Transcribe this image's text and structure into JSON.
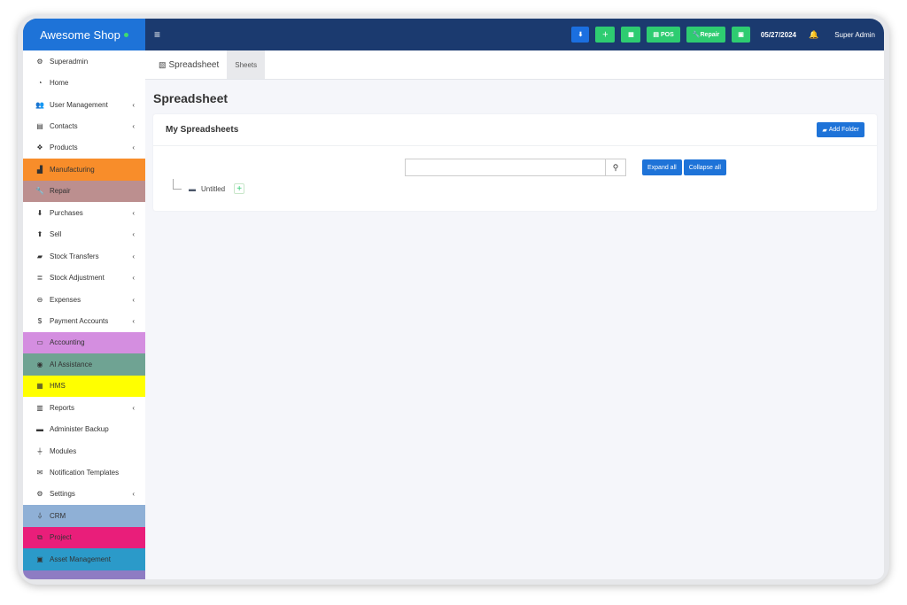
{
  "brand": {
    "name": "Awesome Shop"
  },
  "topbar": {
    "menu_icon": "≡",
    "pos_label": "POS",
    "repair_label": "Repair",
    "date": "05/27/2024",
    "user": "Super Admin"
  },
  "sidebar": {
    "items": [
      {
        "label": "Superadmin",
        "icon": "users-cog-icon",
        "glyph": "⚙",
        "bg": "",
        "chevron": ""
      },
      {
        "label": "Home",
        "icon": "dashboard-icon",
        "glyph": "◔",
        "bg": "",
        "chevron": ""
      },
      {
        "label": "User Management",
        "icon": "users-icon",
        "glyph": "👥",
        "bg": "",
        "chevron": "‹"
      },
      {
        "label": "Contacts",
        "icon": "address-book-icon",
        "glyph": "▤",
        "bg": "",
        "chevron": "‹"
      },
      {
        "label": "Products",
        "icon": "cubes-icon",
        "glyph": "❖",
        "bg": "",
        "chevron": "‹"
      },
      {
        "label": "Manufacturing",
        "icon": "industry-icon",
        "glyph": "▟",
        "bg": "#f88d2a",
        "chevron": ""
      },
      {
        "label": "Repair",
        "icon": "wrench-icon",
        "glyph": "🔧",
        "bg": "#bc8f8f",
        "chevron": ""
      },
      {
        "label": "Purchases",
        "icon": "arrow-circle-down-icon",
        "glyph": "⬇",
        "bg": "",
        "chevron": "‹"
      },
      {
        "label": "Sell",
        "icon": "arrow-circle-up-icon",
        "glyph": "⬆",
        "bg": "",
        "chevron": "‹"
      },
      {
        "label": "Stock Transfers",
        "icon": "truck-icon",
        "glyph": "▰",
        "bg": "",
        "chevron": "‹"
      },
      {
        "label": "Stock Adjustment",
        "icon": "database-icon",
        "glyph": "≣",
        "bg": "",
        "chevron": "‹"
      },
      {
        "label": "Expenses",
        "icon": "minus-circle-icon",
        "glyph": "⊖",
        "bg": "",
        "chevron": "‹"
      },
      {
        "label": "Payment Accounts",
        "icon": "money-icon",
        "glyph": "$",
        "bg": "",
        "chevron": "‹"
      },
      {
        "label": "Accounting",
        "icon": "credit-card-icon",
        "glyph": "▭",
        "bg": "#d48ee0",
        "chevron": ""
      },
      {
        "label": "AI Assistance",
        "icon": "robot-icon",
        "glyph": "◉",
        "bg": "#6fa393",
        "chevron": ""
      },
      {
        "label": "HMS",
        "icon": "hotel-icon",
        "glyph": "▦",
        "bg": "#ffff00",
        "chevron": ""
      },
      {
        "label": "Reports",
        "icon": "bar-chart-icon",
        "glyph": "▥",
        "bg": "",
        "chevron": "‹"
      },
      {
        "label": "Administer Backup",
        "icon": "hdd-icon",
        "glyph": "▬",
        "bg": "",
        "chevron": ""
      },
      {
        "label": "Modules",
        "icon": "plug-icon",
        "glyph": "⏚",
        "bg": "",
        "chevron": ""
      },
      {
        "label": "Notification Templates",
        "icon": "envelope-icon",
        "glyph": "✉",
        "bg": "",
        "chevron": ""
      },
      {
        "label": "Settings",
        "icon": "cog-icon",
        "glyph": "⚙",
        "bg": "",
        "chevron": "‹"
      },
      {
        "label": "CRM",
        "icon": "broadcast-tower-icon",
        "glyph": "⍙",
        "bg": "#8fb0d6",
        "chevron": ""
      },
      {
        "label": "Project",
        "icon": "project-diagram-icon",
        "glyph": "⧉",
        "bg": "#e91e7a",
        "chevron": ""
      },
      {
        "label": "Asset Management",
        "icon": "boxes-icon",
        "glyph": "▣",
        "bg": "#2b9ac9",
        "chevron": ""
      },
      {
        "label": "",
        "icon": "",
        "glyph": "",
        "bg": "#8e7cc3",
        "chevron": ""
      }
    ]
  },
  "tabs": [
    {
      "label": "Spreadsheet",
      "icon": "file-excel-icon"
    },
    {
      "label": "Sheets",
      "icon": ""
    }
  ],
  "page": {
    "title": "Spreadsheet",
    "card_title": "My Spreadsheets",
    "add_folder_label": "Add Folder",
    "search_value": "",
    "expand_all_label": "Expand all",
    "collapse_all_label": "Collapse all",
    "tree": [
      {
        "label": "Untitled",
        "icon": "folder-icon"
      }
    ]
  },
  "colors": {
    "brand": "#1e73d8",
    "topbar": "#1b3a6f",
    "green": "#2ecc71"
  }
}
